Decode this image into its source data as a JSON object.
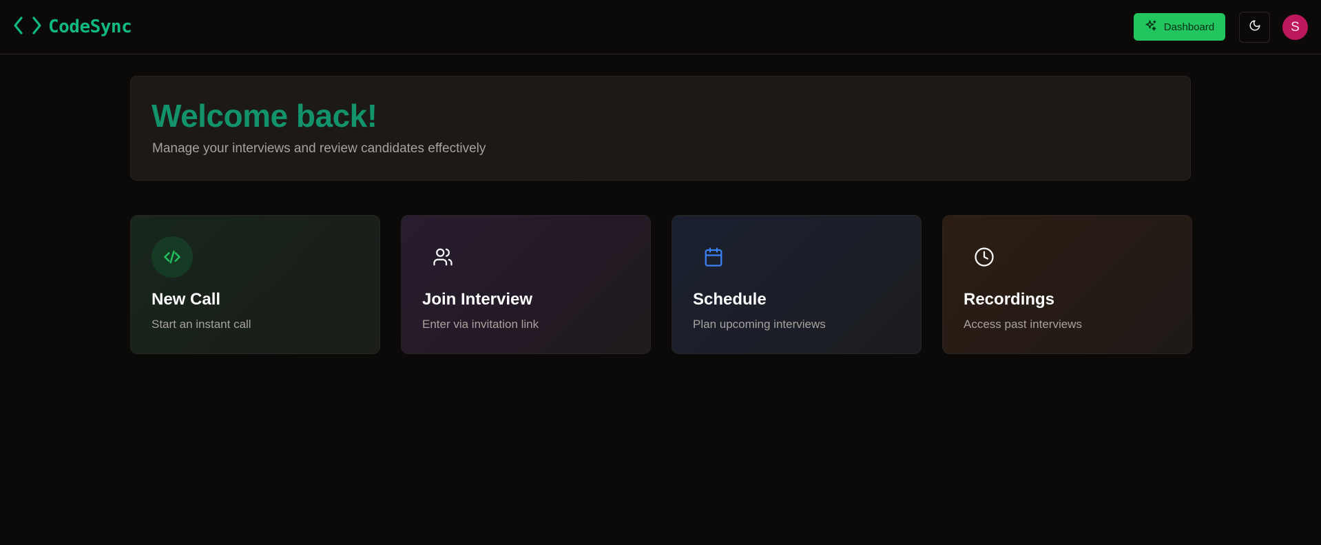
{
  "header": {
    "brand": "CodeSync",
    "brand_icon": "code-brackets-icon",
    "dashboard_label": "Dashboard",
    "dashboard_icon": "sparkles-icon",
    "theme_icon": "moon-icon",
    "avatar_initial": "S"
  },
  "welcome": {
    "title": "Welcome back!",
    "subtitle": "Manage your interviews and review candidates effectively"
  },
  "actions": [
    {
      "title": "New Call",
      "description": "Start an instant call",
      "icon": "code-icon"
    },
    {
      "title": "Join Interview",
      "description": "Enter via invitation link",
      "icon": "users-icon"
    },
    {
      "title": "Schedule",
      "description": "Plan upcoming interviews",
      "icon": "calendar-icon"
    },
    {
      "title": "Recordings",
      "description": "Access past interviews",
      "icon": "clock-icon"
    }
  ],
  "colors": {
    "background": "#0c0a09",
    "brand": "#10b981",
    "dashboard_button": "#22c55e",
    "avatar": "#be185d",
    "welcome_title": "#12936b"
  }
}
